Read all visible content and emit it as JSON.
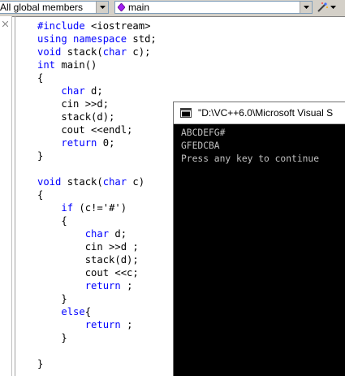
{
  "toolbar": {
    "scope_combo": "All global members",
    "member_combo": "main",
    "wizard_button_icon": "magic-wand-icon"
  },
  "editor": {
    "lines": [
      {
        "t": "#include <iostream>",
        "kw": "#include"
      },
      {
        "t": "using namespace std;",
        "kw": "using namespace"
      },
      {
        "t": "void stack(char c);",
        "kw": "void,char"
      },
      {
        "t": "int main()",
        "kw": "int"
      },
      {
        "t": "{"
      },
      {
        "t": "    char d;",
        "kw": "char"
      },
      {
        "t": "    cin >>d;"
      },
      {
        "t": "    stack(d);"
      },
      {
        "t": "    cout <<endl;"
      },
      {
        "t": "    return 0;",
        "kw": "return"
      },
      {
        "t": "}"
      },
      {
        "t": ""
      },
      {
        "t": "void stack(char c)",
        "kw": "void,char"
      },
      {
        "t": "{"
      },
      {
        "t": "    if (c!='#')",
        "kw": "if"
      },
      {
        "t": "    {"
      },
      {
        "t": "        char d;",
        "kw": "char"
      },
      {
        "t": "        cin >>d ;"
      },
      {
        "t": "        stack(d);"
      },
      {
        "t": "        cout <<c;"
      },
      {
        "t": "        return ;",
        "kw": "return"
      },
      {
        "t": "    }"
      },
      {
        "t": "    else{",
        "kw": "else"
      },
      {
        "t": "        return ;",
        "kw": "return"
      },
      {
        "t": "    }"
      },
      {
        "t": ""
      },
      {
        "t": "}"
      }
    ],
    "keyword_color": "#0000ff"
  },
  "console": {
    "title": "\"D:\\VC++6.0\\Microsoft Visual S",
    "output": [
      "ABCDEFG#",
      "GFEDCBA",
      "Press any key to continue"
    ],
    "background": "#000000",
    "text_color": "#c0c0c0"
  }
}
